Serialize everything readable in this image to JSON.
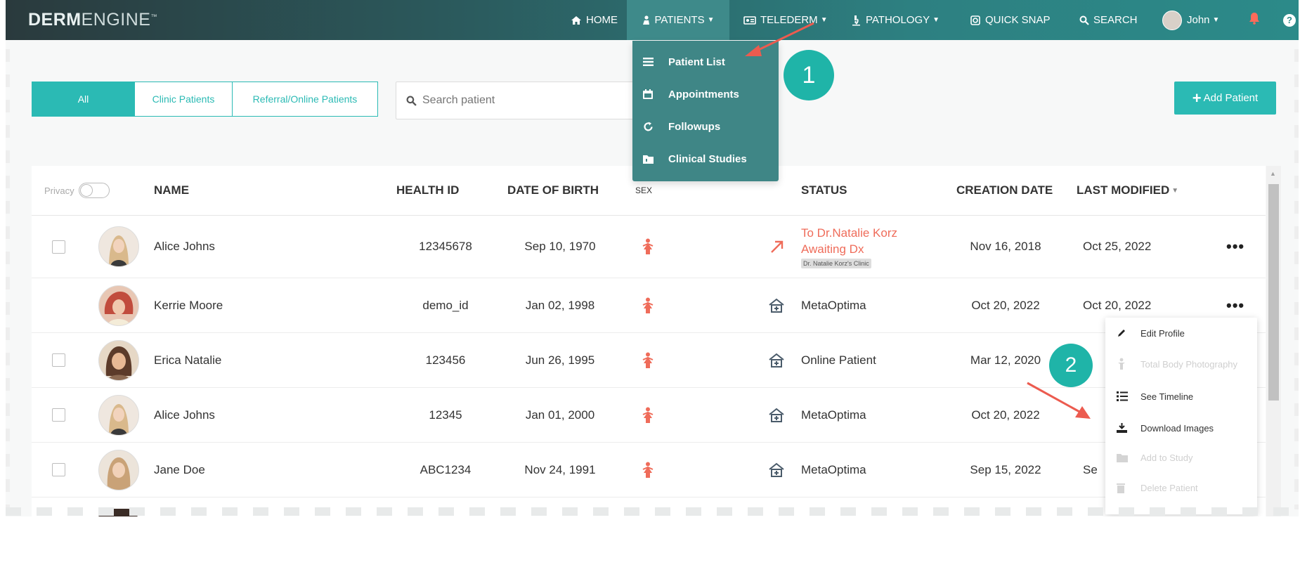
{
  "brand": {
    "bold": "DERM",
    "light": "ENGINE",
    "mark": "™"
  },
  "nav": {
    "home": "HOME",
    "patients": "PATIENTS",
    "telederm": "TELEDERM",
    "pathology": "PATHOLOGY",
    "quick_snap": "QUICK SNAP",
    "search": "SEARCH",
    "user": "John"
  },
  "patients_menu": [
    "Patient List",
    "Appointments",
    "Followups",
    "Clinical Studies"
  ],
  "filters": {
    "tabs": [
      "All",
      "Clinic Patients",
      "Referral/Online Patients"
    ],
    "active_tab": "All",
    "search_placeholder": "Search patient",
    "add_patient": "Add Patient"
  },
  "steps": {
    "one": "1",
    "two": "2"
  },
  "table": {
    "privacy_label": "Privacy",
    "headers": {
      "name": "NAME",
      "health_id": "HEALTH ID",
      "dob": "DATE OF BIRTH",
      "sex": "SEX",
      "status": "STATUS",
      "created": "CREATION DATE",
      "modified": "LAST MODIFIED"
    },
    "rows": [
      {
        "name": "Alice Johns",
        "health_id": "12345678",
        "dob": "Sep 10, 1970",
        "status_line1": "To Dr.Natalie Korz",
        "status_line2": "Awaiting Dx",
        "status_tag": "Dr. Natalie Korz's Clinic",
        "created": "Nov 16, 2018",
        "modified": "Oct 25, 2022"
      },
      {
        "name": "Kerrie Moore",
        "health_id": "demo_id",
        "dob": "Jan 02, 1998",
        "status": "MetaOptima",
        "created": "Oct 20, 2022",
        "modified": "Oct 20, 2022"
      },
      {
        "name": "Erica Natalie",
        "health_id": "123456",
        "dob": "Jun 26, 1995",
        "status": "Online Patient",
        "created": "Mar 12, 2020",
        "modified": ""
      },
      {
        "name": "Alice Johns",
        "health_id": "12345",
        "dob": "Jan 01, 2000",
        "status": "MetaOptima",
        "created": "Oct 20, 2022",
        "modified": ""
      },
      {
        "name": "Jane Doe",
        "health_id": "ABC1234",
        "dob": "Nov 24, 1991",
        "status": "MetaOptima",
        "created": "Sep 15, 2022",
        "modified": "Se"
      }
    ]
  },
  "row_menu": [
    {
      "label": "Edit Profile",
      "enabled": true
    },
    {
      "label": "Total Body Photography",
      "enabled": false
    },
    {
      "label": "See Timeline",
      "enabled": true
    },
    {
      "label": "Download Images",
      "enabled": true
    },
    {
      "label": "Add to Study",
      "enabled": false
    },
    {
      "label": "Delete Patient",
      "enabled": false
    }
  ],
  "colors": {
    "teal": "#2bbab4",
    "badge": "#1fb4a8",
    "alert": "#ef6c5a",
    "nav_dark": "#2a3a3d"
  }
}
